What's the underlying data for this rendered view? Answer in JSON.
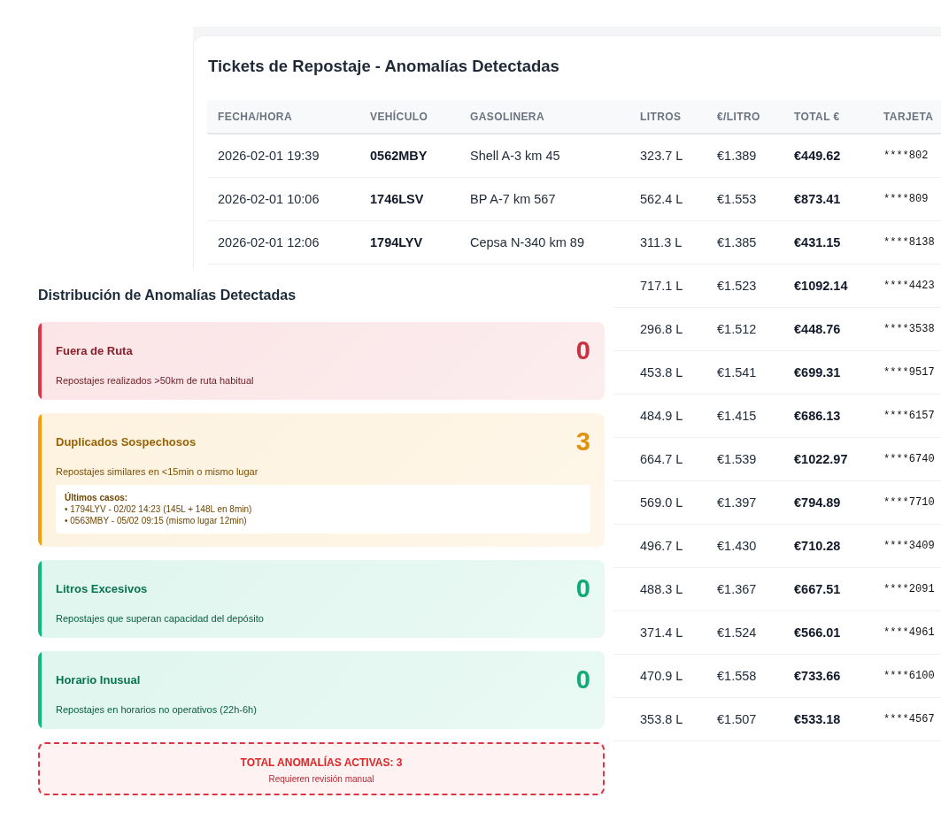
{
  "table_panel": {
    "title": "Tickets de Repostaje - Anomalías Detectadas",
    "columns": [
      "FECHA/HORA",
      "VEHÍCULO",
      "GASOLINERA",
      "LITROS",
      "€/LITRO",
      "TOTAL €",
      "TARJETA"
    ],
    "rows": [
      {
        "fecha_hora": "2026-02-01 19:39",
        "vehiculo": "0562MBY",
        "gasolinera": "Shell A-3 km 45",
        "litros": "323.7 L",
        "precio_litro": "€1.389",
        "total": "€449.62",
        "tarjeta": "****802"
      },
      {
        "fecha_hora": "2026-02-01 10:06",
        "vehiculo": "1746LSV",
        "gasolinera": "BP A-7 km 567",
        "litros": "562.4 L",
        "precio_litro": "€1.553",
        "total": "€873.41",
        "tarjeta": "****809"
      },
      {
        "fecha_hora": "2026-02-01 12:06",
        "vehiculo": "1794LYV",
        "gasolinera": "Cepsa N-340 km 89",
        "litros": "311.3 L",
        "precio_litro": "€1.385",
        "total": "€431.15",
        "tarjeta": "****8138"
      },
      {
        "litros": "717.1 L",
        "precio_litro": "€1.523",
        "total": "€1092.14",
        "tarjeta": "****4423"
      },
      {
        "litros": "296.8 L",
        "precio_litro": "€1.512",
        "total": "€448.76",
        "tarjeta": "****3538"
      },
      {
        "litros": "453.8 L",
        "precio_litro": "€1.541",
        "total": "€699.31",
        "tarjeta": "****9517"
      },
      {
        "litros": "484.9 L",
        "precio_litro": "€1.415",
        "total": "€686.13",
        "tarjeta": "****6157"
      },
      {
        "litros": "664.7 L",
        "precio_litro": "€1.539",
        "total": "€1022.97",
        "tarjeta": "****6740"
      },
      {
        "litros": "569.0 L",
        "precio_litro": "€1.397",
        "total": "€794.89",
        "tarjeta": "****7710"
      },
      {
        "litros": "496.7 L",
        "precio_litro": "€1.430",
        "total": "€710.28",
        "tarjeta": "****3409"
      },
      {
        "litros": "488.3 L",
        "precio_litro": "€1.367",
        "total": "€667.51",
        "tarjeta": "****2091"
      },
      {
        "litros": "371.4 L",
        "precio_litro": "€1.524",
        "total": "€566.01",
        "tarjeta": "****4961"
      },
      {
        "litros": "470.9 L",
        "precio_litro": "€1.558",
        "total": "€733.66",
        "tarjeta": "****6100"
      },
      {
        "litros": "353.8 L",
        "precio_litro": "€1.507",
        "total": "€533.18",
        "tarjeta": "****4567"
      }
    ]
  },
  "anomaly_panel": {
    "title": "Distribución de Anomalías Detectadas",
    "cards": [
      {
        "title": "Fuera de Ruta",
        "count": "0",
        "description": "Repostajes realizados >50km de ruta habitual",
        "color": "#dc3545"
      },
      {
        "title": "Duplicados Sospechosos",
        "count": "3",
        "description": "Repostajes similares en <15min o mismo lugar",
        "color": "#f59e0b",
        "recent_cases": {
          "title": "Últimos casos:",
          "items": [
            "• 1794LYV - 02/02 14:23 (145L + 148L en 8min)",
            "• 0563MBY - 05/02 09:15 (mismo lugar 12min)"
          ]
        }
      },
      {
        "title": "Litros Excesivos",
        "count": "0",
        "description": "Repostajes que superan capacidad del depósito",
        "color": "#10b981"
      },
      {
        "title": "Horario Inusual",
        "count": "0",
        "description": "Repostajes en horarios no operativos (22h-6h)",
        "color": "#10b981"
      }
    ],
    "summary": {
      "title": "TOTAL ANOMALÍAS ACTIVAS: 3",
      "subtitle": "Requieren revisión manual"
    }
  }
}
